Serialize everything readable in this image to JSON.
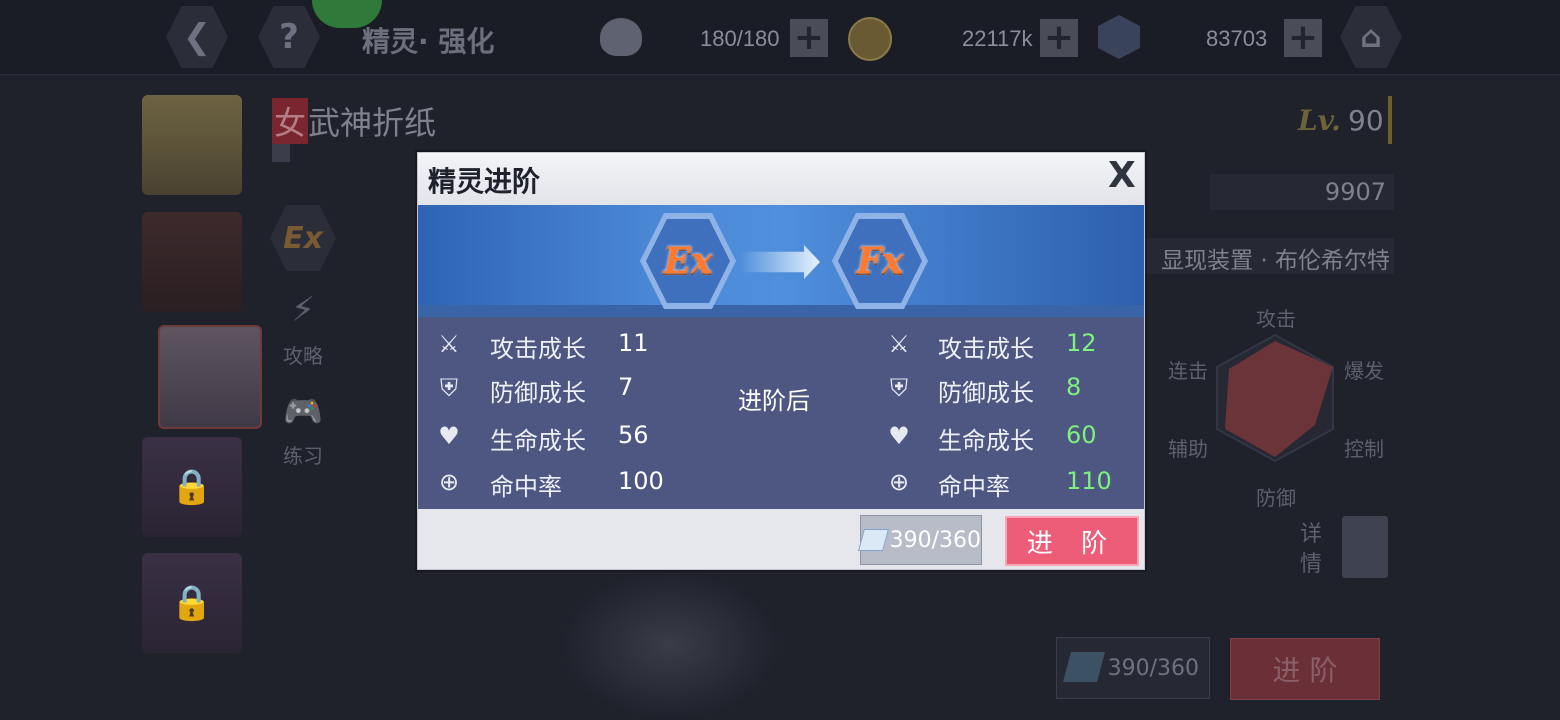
{
  "colors": {
    "accent": "#ee5d78",
    "stat_up": "#7ef07e",
    "panel_blue": "#4e5782"
  },
  "topbar": {
    "back_icon": "chevron-left-icon",
    "help_icon": "question-icon",
    "title": "精灵· 强化",
    "stamina": "180/180",
    "gold": "22117k",
    "crystal": "83703",
    "home_icon": "home-icon"
  },
  "character": {
    "tag": "女",
    "name": "武神折纸",
    "level_prefix": "Lv.",
    "level": "90",
    "power": "9907",
    "equipment": "显现装置 · 布伦希尔特"
  },
  "side_menu": {
    "grade": "Ex",
    "guide": "攻略",
    "practice": "练习"
  },
  "radar": {
    "top": "攻击",
    "left_top": "连击",
    "right_top": "爆发",
    "left_bottom": "辅助",
    "right_bottom": "控制",
    "bottom": "防御"
  },
  "detail_label": "详情",
  "bg_cost": "390/360",
  "bg_advance": "进 阶",
  "modal": {
    "title": "精灵进阶",
    "close": "X",
    "from_grade": "Ex",
    "to_grade": "Fx",
    "after_label": "进阶后",
    "before": [
      {
        "label": "攻击成长",
        "value": "11"
      },
      {
        "label": "防御成长",
        "value": "7"
      },
      {
        "label": "生命成长",
        "value": "56"
      },
      {
        "label": "命中率",
        "value": "100"
      }
    ],
    "after": [
      {
        "label": "攻击成长",
        "value": "12"
      },
      {
        "label": "防御成长",
        "value": "8"
      },
      {
        "label": "生命成长",
        "value": "60"
      },
      {
        "label": "命中率",
        "value": "110"
      }
    ],
    "cost": "390/360",
    "advance_button": "进 阶"
  }
}
